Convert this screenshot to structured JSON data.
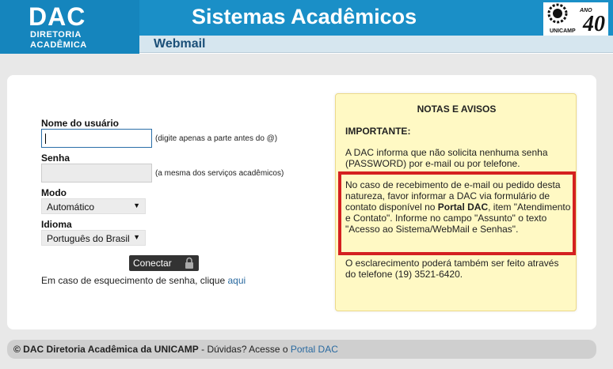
{
  "header": {
    "brand": "DAC",
    "brand_line1": "DIRETORIA",
    "brand_line2": "ACADÊMICA",
    "title": "Sistemas Acadêmicos",
    "subtitle": "Webmail",
    "logo_text": "UNICAMP",
    "anniversary": "ANO",
    "anniversary_num": "40"
  },
  "form": {
    "username_label": "Nome do usuário",
    "username_value": "",
    "username_hint": "(digite apenas a parte antes do @)",
    "password_label": "Senha",
    "password_hint": "(a mesma dos serviços acadêmicos)",
    "mode_label": "Modo",
    "mode_value": "Automático",
    "language_label": "Idioma",
    "language_value": "Português do Brasil",
    "connect_label": "Conectar",
    "forgot_text": "Em caso de esquecimento de senha, clique",
    "forgot_link": "aqui"
  },
  "notes": {
    "title": "NOTAS E AVISOS",
    "important": "IMPORTANTE:",
    "p1": "A DAC informa que não solicita nenhuma senha (PASSWORD) por e-mail ou por telefone.",
    "p2_before": "No caso de recebimento de e-mail ou pedido desta natureza, favor informar a DAC via formulário de contato disponível no",
    "p2_bold": "Portal DAC",
    "p2_after": ", item \"Atendimento e Contato\". Informe no campo \"Assunto\" o texto \"Acesso ao Sistema/WebMail e Senhas\".",
    "p3": "O esclarecimento poderá também ser feito através do telefone (19) 3521-6420."
  },
  "footer": {
    "copyright": "© DAC Diretoria Acadêmica da UNICAMP",
    "separator": " - Dúvidas? Acesse o ",
    "link": "Portal DAC"
  },
  "colors": {
    "banner": "#1a8fc7",
    "notes_bg": "#fff9c4",
    "highlight_border": "#d42020",
    "link": "#2a6aa0"
  }
}
